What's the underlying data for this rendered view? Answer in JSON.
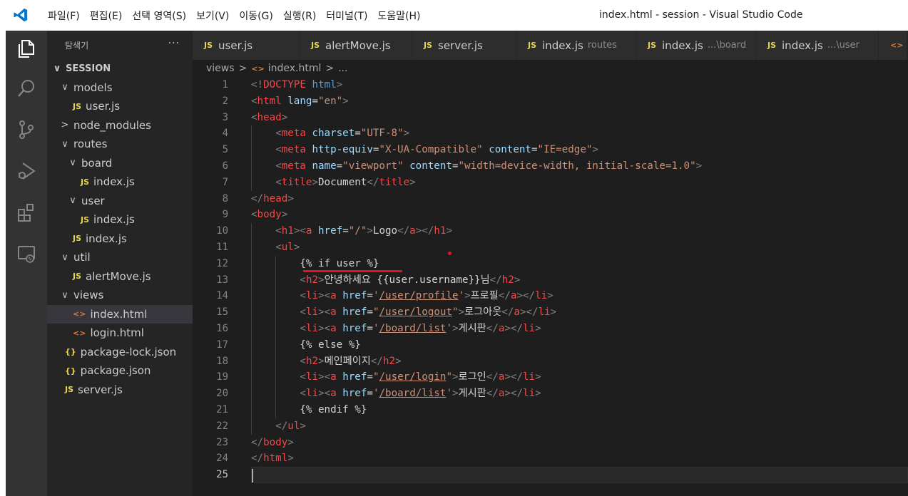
{
  "window": {
    "title": "index.html - session - Visual Studio Code"
  },
  "menu": [
    {
      "label": "파일(F)"
    },
    {
      "label": "편집(E)"
    },
    {
      "label": "선택 영역(S)"
    },
    {
      "label": "보기(V)"
    },
    {
      "label": "이동(G)"
    },
    {
      "label": "실행(R)"
    },
    {
      "label": "터미널(T)"
    },
    {
      "label": "도움말(H)"
    }
  ],
  "sidebar": {
    "title": "탐색기",
    "more": "···",
    "root": "SESSION",
    "items": [
      {
        "label": "models",
        "type": "folder",
        "expanded": true,
        "depth": 1
      },
      {
        "label": "user.js",
        "type": "js",
        "depth": 2
      },
      {
        "label": "node_modules",
        "type": "folder",
        "expanded": false,
        "depth": 1
      },
      {
        "label": "routes",
        "type": "folder",
        "expanded": true,
        "depth": 1
      },
      {
        "label": "board",
        "type": "folder",
        "expanded": true,
        "depth": 2
      },
      {
        "label": "index.js",
        "type": "js",
        "depth": 3
      },
      {
        "label": "user",
        "type": "folder",
        "expanded": true,
        "depth": 2
      },
      {
        "label": "index.js",
        "type": "js",
        "depth": 3
      },
      {
        "label": "index.js",
        "type": "js",
        "depth": 2
      },
      {
        "label": "util",
        "type": "folder",
        "expanded": true,
        "depth": 1
      },
      {
        "label": "alertMove.js",
        "type": "js",
        "depth": 2
      },
      {
        "label": "views",
        "type": "folder",
        "expanded": true,
        "depth": 1
      },
      {
        "label": "index.html",
        "type": "html",
        "depth": 2,
        "selected": true
      },
      {
        "label": "login.html",
        "type": "html",
        "depth": 2
      },
      {
        "label": "package-lock.json",
        "type": "json",
        "depth": 1
      },
      {
        "label": "package.json",
        "type": "json",
        "depth": 1
      },
      {
        "label": "server.js",
        "type": "js",
        "depth": 1
      }
    ]
  },
  "tabs": [
    {
      "label": "user.js",
      "desc": ""
    },
    {
      "label": "alertMove.js",
      "desc": ""
    },
    {
      "label": "server.js",
      "desc": ""
    },
    {
      "label": "index.js",
      "desc": "routes"
    },
    {
      "label": "index.js",
      "desc": "...\\board"
    },
    {
      "label": "index.js",
      "desc": "...\\user"
    }
  ],
  "breadcrumb": {
    "folder": "views",
    "file": "index.html",
    "rest": "..."
  },
  "icons": {
    "js": "JS",
    "html": "<>",
    "json": "{}",
    "chevron_down": "∨",
    "chevron_right": ">",
    "activity": [
      "files-icon",
      "search-icon",
      "source-control-icon",
      "run-debug-icon",
      "extensions-icon",
      "remote-explorer-icon"
    ]
  },
  "colors": {
    "tag": "#569cd6",
    "attr": "#9cdcfe",
    "string": "#ce9178",
    "punct": "#808080",
    "root_tag": "#f44747",
    "annotation": "#e81123",
    "line_number": "#858585"
  },
  "editor": {
    "active_line": 25,
    "lines": [
      {
        "n": "1",
        "indent": 0,
        "tokens": [
          [
            "p",
            "<!"
          ],
          [
            "tr",
            "DOCTYPE"
          ],
          [
            "tx",
            " "
          ],
          [
            "t",
            "html"
          ],
          [
            "p",
            ">"
          ]
        ]
      },
      {
        "n": "2",
        "indent": 0,
        "tokens": [
          [
            "p",
            "<"
          ],
          [
            "tr",
            "html"
          ],
          [
            "tx",
            " "
          ],
          [
            "a",
            "lang"
          ],
          [
            "tx",
            "="
          ],
          [
            "s",
            "\"en\""
          ],
          [
            "p",
            ">"
          ]
        ]
      },
      {
        "n": "3",
        "indent": 0,
        "tokens": [
          [
            "p",
            "<"
          ],
          [
            "tr",
            "head"
          ],
          [
            "p",
            ">"
          ]
        ]
      },
      {
        "n": "4",
        "indent": 1,
        "tokens": [
          [
            "p",
            "<"
          ],
          [
            "tr",
            "meta"
          ],
          [
            "tx",
            " "
          ],
          [
            "a",
            "charset"
          ],
          [
            "tx",
            "="
          ],
          [
            "s",
            "\"UTF-8\""
          ],
          [
            "p",
            ">"
          ]
        ]
      },
      {
        "n": "5",
        "indent": 1,
        "tokens": [
          [
            "p",
            "<"
          ],
          [
            "tr",
            "meta"
          ],
          [
            "tx",
            " "
          ],
          [
            "a",
            "http-equiv"
          ],
          [
            "tx",
            "="
          ],
          [
            "s",
            "\"X-UA-Compatible\""
          ],
          [
            "tx",
            " "
          ],
          [
            "a",
            "content"
          ],
          [
            "tx",
            "="
          ],
          [
            "s",
            "\"IE=edge\""
          ],
          [
            "p",
            ">"
          ]
        ]
      },
      {
        "n": "6",
        "indent": 1,
        "tokens": [
          [
            "p",
            "<"
          ],
          [
            "tr",
            "meta"
          ],
          [
            "tx",
            " "
          ],
          [
            "a",
            "name"
          ],
          [
            "tx",
            "="
          ],
          [
            "s",
            "\"viewport\""
          ],
          [
            "tx",
            " "
          ],
          [
            "a",
            "content"
          ],
          [
            "tx",
            "="
          ],
          [
            "s",
            "\"width=device-width, initial-scale=1.0\""
          ],
          [
            "p",
            ">"
          ]
        ]
      },
      {
        "n": "7",
        "indent": 1,
        "tokens": [
          [
            "p",
            "<"
          ],
          [
            "tr",
            "title"
          ],
          [
            "p",
            ">"
          ],
          [
            "tx",
            "Document"
          ],
          [
            "p",
            "</"
          ],
          [
            "tr",
            "title"
          ],
          [
            "p",
            ">"
          ]
        ]
      },
      {
        "n": "8",
        "indent": 0,
        "tokens": [
          [
            "p",
            "</"
          ],
          [
            "tr",
            "head"
          ],
          [
            "p",
            ">"
          ]
        ]
      },
      {
        "n": "9",
        "indent": 0,
        "tokens": [
          [
            "p",
            "<"
          ],
          [
            "tr",
            "body"
          ],
          [
            "p",
            ">"
          ]
        ]
      },
      {
        "n": "10",
        "indent": 1,
        "tokens": [
          [
            "p",
            "<"
          ],
          [
            "tr",
            "h1"
          ],
          [
            "p",
            ">"
          ],
          [
            "p",
            "<"
          ],
          [
            "tr",
            "a"
          ],
          [
            "tx",
            " "
          ],
          [
            "a",
            "href"
          ],
          [
            "tx",
            "="
          ],
          [
            "s",
            "\"/\""
          ],
          [
            "p",
            ">"
          ],
          [
            "tx",
            "Logo"
          ],
          [
            "p",
            "</"
          ],
          [
            "tr",
            "a"
          ],
          [
            "p",
            ">"
          ],
          [
            "p",
            "</"
          ],
          [
            "tr",
            "h1"
          ],
          [
            "p",
            ">"
          ]
        ]
      },
      {
        "n": "11",
        "indent": 1,
        "tokens": [
          [
            "p",
            "<"
          ],
          [
            "tr",
            "ul"
          ],
          [
            "p",
            ">"
          ]
        ]
      },
      {
        "n": "12",
        "indent": 2,
        "tokens": [
          [
            "tx",
            "{% if user %}"
          ]
        ]
      },
      {
        "n": "13",
        "indent": 2,
        "tokens": [
          [
            "p",
            "<"
          ],
          [
            "tr",
            "h2"
          ],
          [
            "p",
            ">"
          ],
          [
            "tx",
            "안녕하세요 {{user.username}}님"
          ],
          [
            "p",
            "</"
          ],
          [
            "tr",
            "h2"
          ],
          [
            "p",
            ">"
          ]
        ]
      },
      {
        "n": "14",
        "indent": 2,
        "tokens": [
          [
            "p",
            "<"
          ],
          [
            "tr",
            "li"
          ],
          [
            "p",
            ">"
          ],
          [
            "p",
            "<"
          ],
          [
            "tr",
            "a"
          ],
          [
            "tx",
            " "
          ],
          [
            "a",
            "href"
          ],
          [
            "tx",
            "="
          ],
          [
            "s",
            "'"
          ],
          [
            "s ul",
            "/user/profile"
          ],
          [
            "s",
            "'"
          ],
          [
            "p",
            ">"
          ],
          [
            "tx",
            "프로필"
          ],
          [
            "p",
            "</"
          ],
          [
            "tr",
            "a"
          ],
          [
            "p",
            ">"
          ],
          [
            "p",
            "</"
          ],
          [
            "tr",
            "li"
          ],
          [
            "p",
            ">"
          ]
        ]
      },
      {
        "n": "15",
        "indent": 2,
        "tokens": [
          [
            "p",
            "<"
          ],
          [
            "tr",
            "li"
          ],
          [
            "p",
            ">"
          ],
          [
            "p",
            "<"
          ],
          [
            "tr",
            "a"
          ],
          [
            "tx",
            " "
          ],
          [
            "a",
            "href"
          ],
          [
            "tx",
            "="
          ],
          [
            "s",
            "\""
          ],
          [
            "s ul",
            "/user/logout"
          ],
          [
            "s",
            "\""
          ],
          [
            "p",
            ">"
          ],
          [
            "tx",
            "로그아웃"
          ],
          [
            "p",
            "</"
          ],
          [
            "tr",
            "a"
          ],
          [
            "p",
            ">"
          ],
          [
            "p",
            "</"
          ],
          [
            "tr",
            "li"
          ],
          [
            "p",
            ">"
          ]
        ]
      },
      {
        "n": "16",
        "indent": 2,
        "tokens": [
          [
            "p",
            "<"
          ],
          [
            "tr",
            "li"
          ],
          [
            "p",
            ">"
          ],
          [
            "p",
            "<"
          ],
          [
            "tr",
            "a"
          ],
          [
            "tx",
            " "
          ],
          [
            "a",
            "href"
          ],
          [
            "tx",
            "="
          ],
          [
            "s",
            "'"
          ],
          [
            "s ul",
            "/board/list"
          ],
          [
            "s",
            "'"
          ],
          [
            "p",
            ">"
          ],
          [
            "tx",
            "게시판"
          ],
          [
            "p",
            "</"
          ],
          [
            "tr",
            "a"
          ],
          [
            "p",
            ">"
          ],
          [
            "p",
            "</"
          ],
          [
            "tr",
            "li"
          ],
          [
            "p",
            ">"
          ]
        ]
      },
      {
        "n": "17",
        "indent": 2,
        "tokens": [
          [
            "tx",
            "{% else %}"
          ]
        ]
      },
      {
        "n": "18",
        "indent": 2,
        "tokens": [
          [
            "p",
            "<"
          ],
          [
            "tr",
            "h2"
          ],
          [
            "p",
            ">"
          ],
          [
            "tx",
            "메인페이지"
          ],
          [
            "p",
            "</"
          ],
          [
            "tr",
            "h2"
          ],
          [
            "p",
            ">"
          ]
        ]
      },
      {
        "n": "19",
        "indent": 2,
        "tokens": [
          [
            "p",
            "<"
          ],
          [
            "tr",
            "li"
          ],
          [
            "p",
            ">"
          ],
          [
            "p",
            "<"
          ],
          [
            "tr",
            "a"
          ],
          [
            "tx",
            " "
          ],
          [
            "a",
            "href"
          ],
          [
            "tx",
            "="
          ],
          [
            "s",
            "\""
          ],
          [
            "s ul",
            "/user/login"
          ],
          [
            "s",
            "\""
          ],
          [
            "p",
            ">"
          ],
          [
            "tx",
            "로그인"
          ],
          [
            "p",
            "</"
          ],
          [
            "tr",
            "a"
          ],
          [
            "p",
            ">"
          ],
          [
            "p",
            "</"
          ],
          [
            "tr",
            "li"
          ],
          [
            "p",
            ">"
          ]
        ]
      },
      {
        "n": "20",
        "indent": 2,
        "tokens": [
          [
            "p",
            "<"
          ],
          [
            "tr",
            "li"
          ],
          [
            "p",
            ">"
          ],
          [
            "p",
            "<"
          ],
          [
            "tr",
            "a"
          ],
          [
            "tx",
            " "
          ],
          [
            "a",
            "href"
          ],
          [
            "tx",
            "="
          ],
          [
            "s",
            "'"
          ],
          [
            "s ul",
            "/board/list"
          ],
          [
            "s",
            "'"
          ],
          [
            "p",
            ">"
          ],
          [
            "tx",
            "게시판"
          ],
          [
            "p",
            "</"
          ],
          [
            "tr",
            "a"
          ],
          [
            "p",
            ">"
          ],
          [
            "p",
            "</"
          ],
          [
            "tr",
            "li"
          ],
          [
            "p",
            ">"
          ]
        ]
      },
      {
        "n": "21",
        "indent": 2,
        "tokens": [
          [
            "tx",
            "{% endif %}"
          ]
        ]
      },
      {
        "n": "22",
        "indent": 1,
        "tokens": [
          [
            "p",
            "</"
          ],
          [
            "tr",
            "ul"
          ],
          [
            "p",
            ">"
          ]
        ]
      },
      {
        "n": "23",
        "indent": 0,
        "tokens": [
          [
            "p",
            "</"
          ],
          [
            "tr",
            "body"
          ],
          [
            "p",
            ">"
          ]
        ]
      },
      {
        "n": "24",
        "indent": 0,
        "tokens": [
          [
            "p",
            "</"
          ],
          [
            "tr",
            "html"
          ],
          [
            "p",
            ">"
          ]
        ]
      },
      {
        "n": "25",
        "indent": 0,
        "tokens": []
      }
    ]
  }
}
